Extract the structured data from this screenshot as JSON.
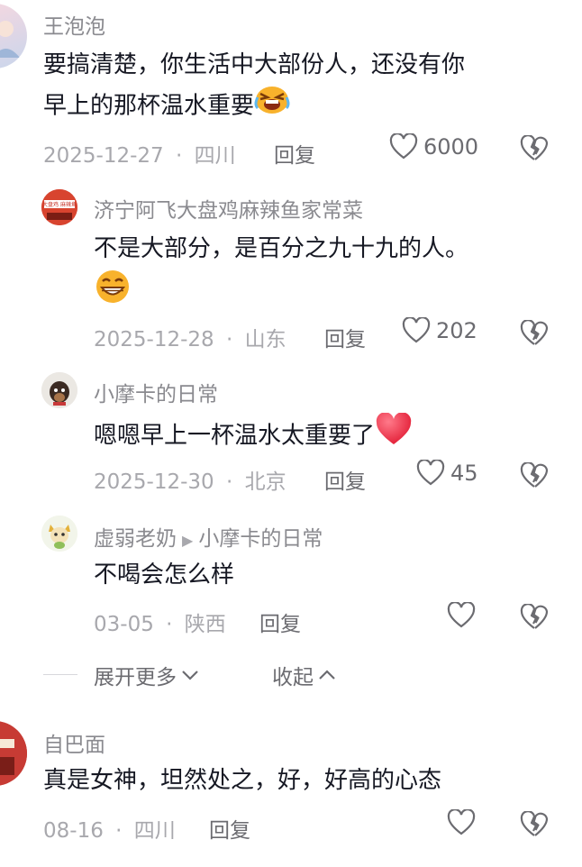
{
  "comments": [
    {
      "name": "王泡泡",
      "line1": "要搞清楚，你生活中大部份人，还没有你",
      "line2": "早上的那杯温水重要",
      "emoji": "laughing-crying-emoji",
      "date": "2025-12-27",
      "location": "四川",
      "reply_label": "回复",
      "likes": "6000"
    },
    {
      "name": "济宁阿飞大盘鸡麻辣鱼家常菜",
      "avatar_text": "大盘鸡 麻辣鱼",
      "line1": "不是大部分，是百分之九十九的人。",
      "emoji": "grinning-emoji",
      "date": "2025-12-28",
      "location": "山东",
      "reply_label": "回复",
      "likes": "202"
    },
    {
      "name": "小摩卡的日常",
      "line1": "嗯嗯早上一杯温水太重要了",
      "emoji": "red-heart-emoji",
      "date": "2025-12-30",
      "location": "北京",
      "reply_label": "回复",
      "likes": "45"
    },
    {
      "name": "虚弱老奶",
      "reply_to": "小摩卡的日常",
      "line1": "不喝会怎么样",
      "date": "03-05",
      "location": "陕西",
      "reply_label": "回复",
      "likes": ""
    },
    {
      "name": "自巴面",
      "line1": "真是女神，坦然处之，好，好高的心态",
      "date": "08-16",
      "location": "四川",
      "reply_label": "回复",
      "likes": ""
    }
  ],
  "expand": {
    "more_label": "展开更多",
    "collapse_label": "收起"
  },
  "separator": "·",
  "colors": {
    "text": "#161823",
    "name": "#8a8a8f",
    "meta": "#a8a8ad",
    "heart_red": "#f0304a"
  }
}
